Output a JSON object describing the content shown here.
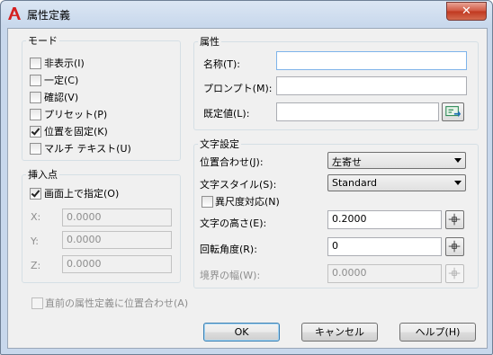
{
  "window": {
    "title": "属性定義",
    "close_glyph": "✕"
  },
  "mode": {
    "label": "モード",
    "options": [
      {
        "label": "非表示(I)",
        "checked": false
      },
      {
        "label": "一定(C)",
        "checked": false
      },
      {
        "label": "確認(V)",
        "checked": false
      },
      {
        "label": "プリセット(P)",
        "checked": false
      },
      {
        "label": "位置を固定(K)",
        "checked": true
      },
      {
        "label": "マルチ テキスト(U)",
        "checked": false
      }
    ]
  },
  "insertion": {
    "label": "挿入点",
    "specify_on_screen": {
      "label": "画面上で指定(O)",
      "checked": true
    },
    "x": {
      "label": "X:",
      "value": "0.0000"
    },
    "y": {
      "label": "Y:",
      "value": "0.0000"
    },
    "z": {
      "label": "Z:",
      "value": "0.0000"
    }
  },
  "attribute": {
    "label": "属性",
    "tag": {
      "label": "名称(T):",
      "value": ""
    },
    "prompt": {
      "label": "プロンプト(M):",
      "value": ""
    },
    "default": {
      "label": "既定値(L):",
      "value": ""
    }
  },
  "text_settings": {
    "label": "文字設定",
    "justification": {
      "label": "位置合わせ(J):",
      "value": "左寄せ"
    },
    "text_style": {
      "label": "文字スタイル(S):",
      "value": "Standard"
    },
    "annotative": {
      "label": "異尺度対応(N)",
      "checked": false
    },
    "text_height": {
      "label": "文字の高さ(E):",
      "value": "0.2000"
    },
    "rotation": {
      "label": "回転角度(R):",
      "value": "0"
    },
    "boundary_width": {
      "label": "境界の幅(W):",
      "value": "0.0000"
    }
  },
  "align_below_previous": {
    "label": "直前の属性定義に位置合わせ(A)",
    "checked": false
  },
  "buttons": {
    "ok": "OK",
    "cancel": "キャンセル",
    "help": "ヘルプ(H)"
  },
  "colors": {
    "accent": "#3c7fb1",
    "icon_red": "#d42020",
    "insert_field_icon": "#2e8b57"
  }
}
